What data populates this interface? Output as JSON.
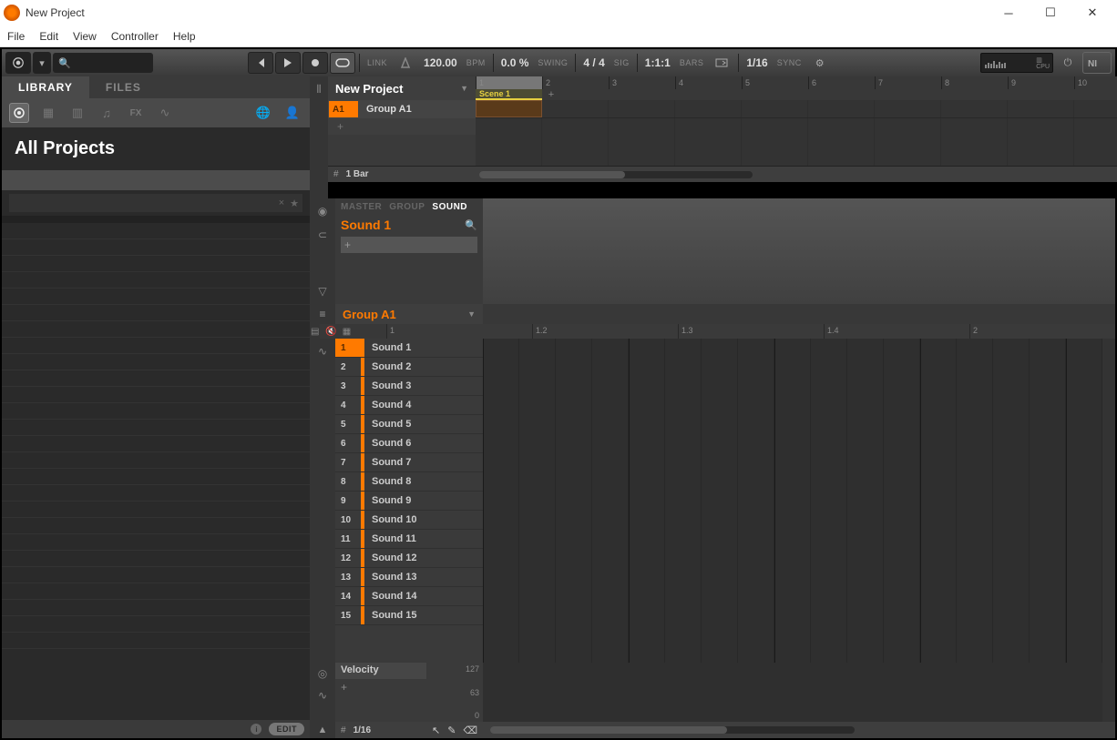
{
  "window": {
    "title": "New Project"
  },
  "menu": {
    "items": [
      "File",
      "Edit",
      "View",
      "Controller",
      "Help"
    ]
  },
  "transport": {
    "link": "LINK",
    "bpm": "120.00",
    "bpm_label": "BPM",
    "swing": "0.0 %",
    "swing_label": "SWING",
    "sig": "4 / 4",
    "sig_label": "SIG",
    "position": "1:1:1",
    "bars_label": "BARS",
    "grid": "1/16",
    "sync_label": "SYNC"
  },
  "browser": {
    "tabs": {
      "library": "LIBRARY",
      "files": "FILES"
    },
    "header": "All Projects",
    "footer": {
      "edit": "EDIT"
    }
  },
  "arranger": {
    "project": "New Project",
    "rulers": [
      "1",
      "2",
      "3",
      "4",
      "5",
      "6",
      "7",
      "8",
      "9",
      "10"
    ],
    "scene": "Scene 1",
    "group": {
      "tag": "A1",
      "name": "Group A1"
    },
    "zoom_label": "1 Bar"
  },
  "plugin": {
    "tabs": {
      "master": "MASTER",
      "group": "GROUP",
      "sound": "SOUND"
    },
    "sound_name": "Sound 1"
  },
  "pattern": {
    "group": "Group A1",
    "rulers": [
      "1",
      "1.2",
      "1.3",
      "1.4",
      "2"
    ],
    "sounds": [
      {
        "n": "1",
        "name": "Sound 1"
      },
      {
        "n": "2",
        "name": "Sound 2"
      },
      {
        "n": "3",
        "name": "Sound 3"
      },
      {
        "n": "4",
        "name": "Sound 4"
      },
      {
        "n": "5",
        "name": "Sound 5"
      },
      {
        "n": "6",
        "name": "Sound 6"
      },
      {
        "n": "7",
        "name": "Sound 7"
      },
      {
        "n": "8",
        "name": "Sound 8"
      },
      {
        "n": "9",
        "name": "Sound 9"
      },
      {
        "n": "10",
        "name": "Sound 10"
      },
      {
        "n": "11",
        "name": "Sound 11"
      },
      {
        "n": "12",
        "name": "Sound 12"
      },
      {
        "n": "13",
        "name": "Sound 13"
      },
      {
        "n": "14",
        "name": "Sound 14"
      },
      {
        "n": "15",
        "name": "Sound 15"
      }
    ],
    "grid_label": "1/16"
  },
  "velocity": {
    "label": "Velocity",
    "max": "127",
    "mid": "63",
    "min": "0"
  }
}
